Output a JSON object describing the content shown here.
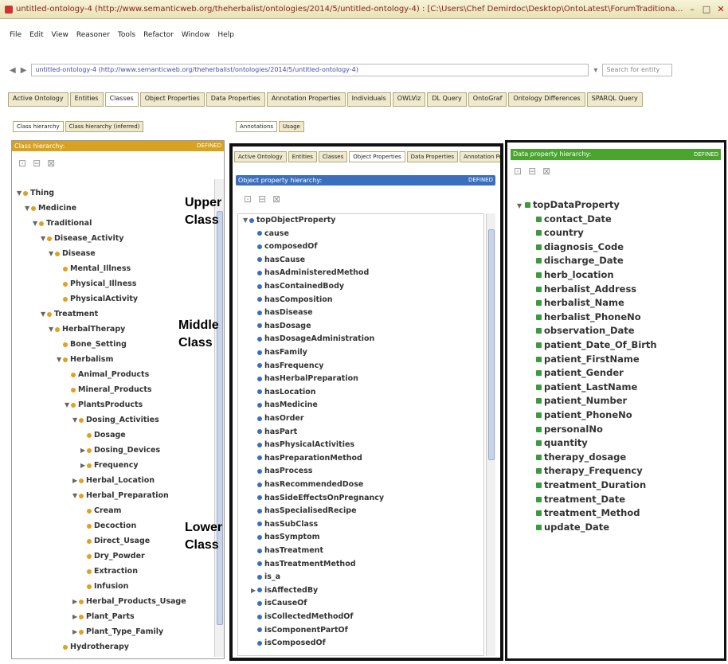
{
  "window": {
    "title": "untitled-ontology-4 (http://www.semanticweb.org/theherbalist/ontologies/2014/5/untitled-ontology-4) : [C:\\Users\\Chef Demirdoc\\Desktop\\OntoLatest\\ForumTraditional Medicine.owl]"
  },
  "menu": [
    "File",
    "Edit",
    "View",
    "Reasoner",
    "Tools",
    "Refactor",
    "Window",
    "Help"
  ],
  "address": {
    "value": "untitled-ontology-4 (http://www.semanticweb.org/theherbalist/ontologies/2014/5/untitled-ontology-4)",
    "search_placeholder": "Search for entity"
  },
  "main_tabs": [
    "Active Ontology",
    "Entities",
    "Classes",
    "Object Properties",
    "Data Properties",
    "Annotation Properties",
    "Individuals",
    "OWLViz",
    "DL Query",
    "OntoGraf",
    "Ontology Differences",
    "SPARQL Query"
  ],
  "main_tab_active": 2,
  "left_subtabs": [
    "Class hierarchy",
    "Class hierarchy (inferred)"
  ],
  "center_subtabs": [
    "Annotations",
    "Usage"
  ],
  "left_panel": {
    "header": "Class hierarchy:",
    "tag": "DEFINED",
    "tree": [
      {
        "label": "Thing",
        "level": 0,
        "tw": "▼"
      },
      {
        "label": "Medicine",
        "level": 1,
        "tw": "▼"
      },
      {
        "label": "Traditional",
        "level": 2,
        "tw": "▼"
      },
      {
        "label": "Disease_Activity",
        "level": 3,
        "tw": "▼"
      },
      {
        "label": "Disease",
        "level": 4,
        "tw": "▼"
      },
      {
        "label": "Mental_Illness",
        "level": 5,
        "tw": ""
      },
      {
        "label": "Physical_Illness",
        "level": 5,
        "tw": ""
      },
      {
        "label": "PhysicalActivity",
        "level": 5,
        "tw": ""
      },
      {
        "label": "Treatment",
        "level": 3,
        "tw": "▼"
      },
      {
        "label": "HerbalTherapy",
        "level": 4,
        "tw": "▼"
      },
      {
        "label": "Bone_Setting",
        "level": 5,
        "tw": ""
      },
      {
        "label": "Herbalism",
        "level": 5,
        "tw": "▼"
      },
      {
        "label": "Animal_Products",
        "level": 6,
        "tw": ""
      },
      {
        "label": "Mineral_Products",
        "level": 6,
        "tw": ""
      },
      {
        "label": "PlantsProducts",
        "level": 6,
        "tw": "▼"
      },
      {
        "label": "Dosing_Activities",
        "level": 7,
        "tw": "▼"
      },
      {
        "label": "Dosage",
        "level": 8,
        "tw": ""
      },
      {
        "label": "Dosing_Devices",
        "level": 8,
        "tw": "▶"
      },
      {
        "label": "Frequency",
        "level": 8,
        "tw": "▶"
      },
      {
        "label": "Herbal_Location",
        "level": 7,
        "tw": "▶"
      },
      {
        "label": "Herbal_Preparation",
        "level": 7,
        "tw": "▼"
      },
      {
        "label": "Cream",
        "level": 8,
        "tw": ""
      },
      {
        "label": "Decoction",
        "level": 8,
        "tw": ""
      },
      {
        "label": "Direct_Usage",
        "level": 8,
        "tw": ""
      },
      {
        "label": "Dry_Powder",
        "level": 8,
        "tw": ""
      },
      {
        "label": "Extraction",
        "level": 8,
        "tw": ""
      },
      {
        "label": "Infusion",
        "level": 8,
        "tw": ""
      },
      {
        "label": "Herbal_Products_Usage",
        "level": 7,
        "tw": "▶"
      },
      {
        "label": "Plant_Parts",
        "level": 7,
        "tw": "▶"
      },
      {
        "label": "Plant_Type_Family",
        "level": 7,
        "tw": "▶"
      },
      {
        "label": "Hydrotherapy",
        "level": 5,
        "tw": ""
      }
    ]
  },
  "annotations": {
    "upper": "Upper\nClass",
    "middle": "Middle\nClass",
    "lower": "Lower\nClass"
  },
  "middle_panel": {
    "tabs": [
      "Active Ontology",
      "Entities",
      "Classes",
      "Object Properties",
      "Data Properties",
      "Annotation Properties"
    ],
    "active_tab": 3,
    "header": "Object property hierarchy:",
    "tag": "DEFINED",
    "items": [
      {
        "label": "topObjectProperty",
        "level": 0,
        "tw": "▼"
      },
      {
        "label": "cause",
        "level": 1,
        "tw": ""
      },
      {
        "label": "composedOf",
        "level": 1,
        "tw": ""
      },
      {
        "label": "hasCause",
        "level": 1,
        "tw": ""
      },
      {
        "label": "hasAdministeredMethod",
        "level": 1,
        "tw": ""
      },
      {
        "label": "hasContainedBody",
        "level": 1,
        "tw": ""
      },
      {
        "label": "hasComposition",
        "level": 1,
        "tw": ""
      },
      {
        "label": "hasDisease",
        "level": 1,
        "tw": ""
      },
      {
        "label": "hasDosage",
        "level": 1,
        "tw": ""
      },
      {
        "label": "hasDosageAdministration",
        "level": 1,
        "tw": ""
      },
      {
        "label": "hasFamily",
        "level": 1,
        "tw": ""
      },
      {
        "label": "hasFrequency",
        "level": 1,
        "tw": ""
      },
      {
        "label": "hasHerbalPreparation",
        "level": 1,
        "tw": ""
      },
      {
        "label": "hasLocation",
        "level": 1,
        "tw": ""
      },
      {
        "label": "hasMedicine",
        "level": 1,
        "tw": ""
      },
      {
        "label": "hasOrder",
        "level": 1,
        "tw": ""
      },
      {
        "label": "hasPart",
        "level": 1,
        "tw": ""
      },
      {
        "label": "hasPhysicalActivities",
        "level": 1,
        "tw": ""
      },
      {
        "label": "hasPreparationMethod",
        "level": 1,
        "tw": ""
      },
      {
        "label": "hasProcess",
        "level": 1,
        "tw": ""
      },
      {
        "label": "hasRecommendedDose",
        "level": 1,
        "tw": ""
      },
      {
        "label": "hasSideEffectsOnPregnancy",
        "level": 1,
        "tw": ""
      },
      {
        "label": "hasSpecialisedRecipe",
        "level": 1,
        "tw": ""
      },
      {
        "label": "hasSubClass",
        "level": 1,
        "tw": ""
      },
      {
        "label": "hasSymptom",
        "level": 1,
        "tw": ""
      },
      {
        "label": "hasTreatment",
        "level": 1,
        "tw": ""
      },
      {
        "label": "hasTreatmentMethod",
        "level": 1,
        "tw": ""
      },
      {
        "label": "is_a",
        "level": 1,
        "tw": ""
      },
      {
        "label": "isAffectedBy",
        "level": 1,
        "tw": "▶"
      },
      {
        "label": "isCauseOf",
        "level": 1,
        "tw": ""
      },
      {
        "label": "isCollectedMethodOf",
        "level": 1,
        "tw": ""
      },
      {
        "label": "isComponentPartOf",
        "level": 1,
        "tw": ""
      },
      {
        "label": "isComposedOf",
        "level": 1,
        "tw": ""
      }
    ]
  },
  "right_panel": {
    "header": "Data property hierarchy:",
    "tag": "DEFINED",
    "items": [
      {
        "label": "topDataProperty",
        "level": 0,
        "tw": "▼"
      },
      {
        "label": "contact_Date",
        "level": 1,
        "tw": ""
      },
      {
        "label": "country",
        "level": 1,
        "tw": ""
      },
      {
        "label": "diagnosis_Code",
        "level": 1,
        "tw": ""
      },
      {
        "label": "discharge_Date",
        "level": 1,
        "tw": ""
      },
      {
        "label": "herb_location",
        "level": 1,
        "tw": ""
      },
      {
        "label": "herbalist_Address",
        "level": 1,
        "tw": ""
      },
      {
        "label": "herbalist_Name",
        "level": 1,
        "tw": ""
      },
      {
        "label": "herbalist_PhoneNo",
        "level": 1,
        "tw": ""
      },
      {
        "label": "observation_Date",
        "level": 1,
        "tw": ""
      },
      {
        "label": "patient_Date_Of_Birth",
        "level": 1,
        "tw": ""
      },
      {
        "label": "patient_FirstName",
        "level": 1,
        "tw": ""
      },
      {
        "label": "patient_Gender",
        "level": 1,
        "tw": ""
      },
      {
        "label": "patient_LastName",
        "level": 1,
        "tw": ""
      },
      {
        "label": "patient_Number",
        "level": 1,
        "tw": ""
      },
      {
        "label": "patient_PhoneNo",
        "level": 1,
        "tw": ""
      },
      {
        "label": "personalNo",
        "level": 1,
        "tw": ""
      },
      {
        "label": "quantity",
        "level": 1,
        "tw": ""
      },
      {
        "label": "therapy_dosage",
        "level": 1,
        "tw": ""
      },
      {
        "label": "therapy_Frequency",
        "level": 1,
        "tw": ""
      },
      {
        "label": "treatment_Duration",
        "level": 1,
        "tw": ""
      },
      {
        "label": "treatment_Date",
        "level": 1,
        "tw": ""
      },
      {
        "label": "treatment_Method",
        "level": 1,
        "tw": ""
      },
      {
        "label": "update_Date",
        "level": 1,
        "tw": ""
      }
    ]
  },
  "colors": {
    "class_dot": "#e0a020",
    "object_property_dot": "#3a6fc0",
    "data_property_dot": "#3b9a3b",
    "left_header": "#d7a220",
    "middle_header": "#3a6fc0",
    "right_header": "#4aa52e"
  },
  "icons": {
    "window_min": "minimize-icon",
    "window_close": "close-icon",
    "back": "back-arrow-icon",
    "forward": "forward-arrow-icon"
  }
}
